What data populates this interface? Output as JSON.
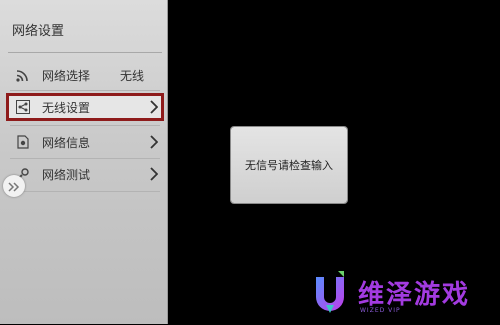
{
  "sidebar": {
    "title": "网络设置",
    "items": [
      {
        "label": "网络选择",
        "value": "无线",
        "icon": "wifi-icon"
      },
      {
        "label": "无线设置",
        "icon": "share-icon",
        "selected": true,
        "has_arrow": true
      },
      {
        "label": "网络信息",
        "icon": "info-doc-icon",
        "has_arrow": true
      },
      {
        "label": "网络测试",
        "icon": "test-icon",
        "has_arrow": true
      }
    ]
  },
  "dialog": {
    "message": "无信号请检查输入"
  },
  "watermark": {
    "name": "维泽游戏",
    "sub": "WIZED VIP"
  },
  "colors": {
    "selection_border": "#8e1b1b",
    "brand": "#a33be0"
  }
}
